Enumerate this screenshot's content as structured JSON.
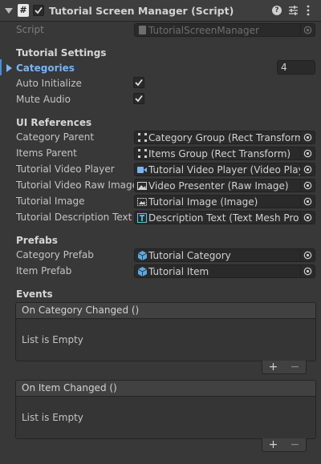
{
  "header": {
    "title": "Tutorial Screen Manager (Script)",
    "icons": [
      "collapse-triangle-icon",
      "script-hash-icon",
      "enabled-checkbox",
      "help-icon",
      "presets-icon",
      "kebab-menu-icon"
    ]
  },
  "script": {
    "label": "Script",
    "value": "TutorialScreenManager"
  },
  "tutorial_settings": {
    "heading": "Tutorial Settings",
    "categories_label": "Categories",
    "categories_count": "4",
    "auto_initialize_label": "Auto Initialize",
    "auto_initialize": true,
    "mute_audio_label": "Mute Audio",
    "mute_audio": true
  },
  "ui_references": {
    "heading": "UI References",
    "fields": [
      {
        "label": "Category Parent",
        "value": "Category Group (Rect Transform)",
        "icon": "rect-transform-icon"
      },
      {
        "label": "Items Parent",
        "value": "Items Group (Rect Transform)",
        "icon": "rect-transform-icon"
      },
      {
        "label": "Tutorial Video Player",
        "value": "Tutorial Video Player (Video Player",
        "icon": "video-player-icon"
      },
      {
        "label": "Tutorial Video Raw Image",
        "value": "Video Presenter (Raw Image)",
        "icon": "raw-image-icon"
      },
      {
        "label": "Tutorial Image",
        "value": "Tutorial Image (Image)",
        "icon": "image-icon"
      },
      {
        "label": "Tutorial Description Text",
        "value": "Description Text (Text Mesh Pro U",
        "icon": "text-mesh-pro-icon"
      }
    ]
  },
  "prefabs": {
    "heading": "Prefabs",
    "fields": [
      {
        "label": "Category Prefab",
        "value": "Tutorial Category",
        "icon": "prefab-icon"
      },
      {
        "label": "Item Prefab",
        "value": "Tutorial Item",
        "icon": "prefab-icon"
      }
    ]
  },
  "events": {
    "heading": "Events",
    "items": [
      {
        "title": "On Category Changed ()",
        "empty_text": "List is Empty",
        "add": "+",
        "remove": "−"
      },
      {
        "title": "On Item Changed ()",
        "empty_text": "List is Empty",
        "add": "+",
        "remove": "−"
      }
    ]
  },
  "colors": {
    "background": "#383838",
    "accent_blue": "#7ab3f2",
    "header": "#3e3e3e"
  }
}
